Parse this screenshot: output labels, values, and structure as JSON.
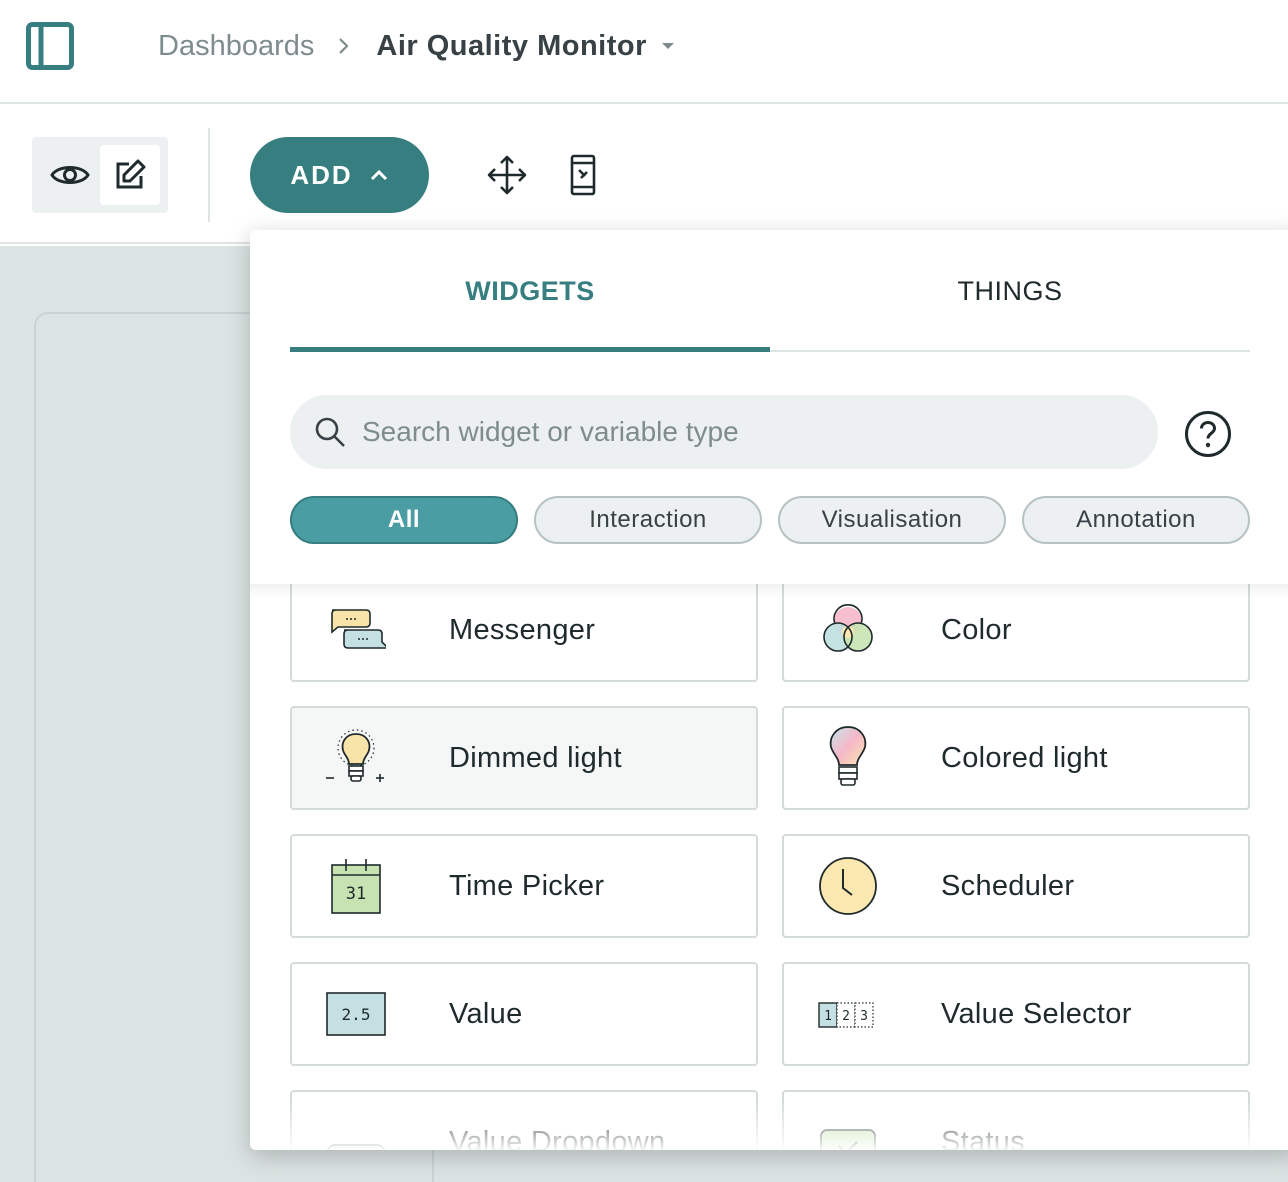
{
  "header": {
    "breadcrumb_root": "Dashboards",
    "breadcrumb_current": "Air Quality Monitor"
  },
  "toolbar": {
    "add_label": "ADD"
  },
  "panel": {
    "tabs": [
      {
        "label": "WIDGETS",
        "active": true
      },
      {
        "label": "THINGS",
        "active": false
      }
    ],
    "search_placeholder": "Search widget or variable type",
    "filters": [
      {
        "label": "All",
        "active": true
      },
      {
        "label": "Interaction",
        "active": false
      },
      {
        "label": "Visualisation",
        "active": false
      },
      {
        "label": "Annotation",
        "active": false
      }
    ],
    "widgets": [
      {
        "label": "Messenger",
        "icon": "messenger-icon"
      },
      {
        "label": "Color",
        "icon": "color-icon"
      },
      {
        "label": "Dimmed light",
        "icon": "dimmed-light-icon"
      },
      {
        "label": "Colored light",
        "icon": "colored-light-icon"
      },
      {
        "label": "Time Picker",
        "icon": "calendar-icon",
        "icon_text": "31"
      },
      {
        "label": "Scheduler",
        "icon": "clock-icon"
      },
      {
        "label": "Value",
        "icon": "value-icon",
        "icon_text": "2.5"
      },
      {
        "label": "Value Selector",
        "icon": "value-selector-icon",
        "icon_digits": [
          "1",
          "2",
          "3"
        ]
      },
      {
        "label": "Value Dropdown",
        "icon": "dropdown-icon"
      },
      {
        "label": "Status",
        "icon": "status-icon"
      }
    ]
  },
  "colors": {
    "accent": "#367e7f",
    "chip_active": "#4a9ea3",
    "canvas": "#dce4e3"
  }
}
